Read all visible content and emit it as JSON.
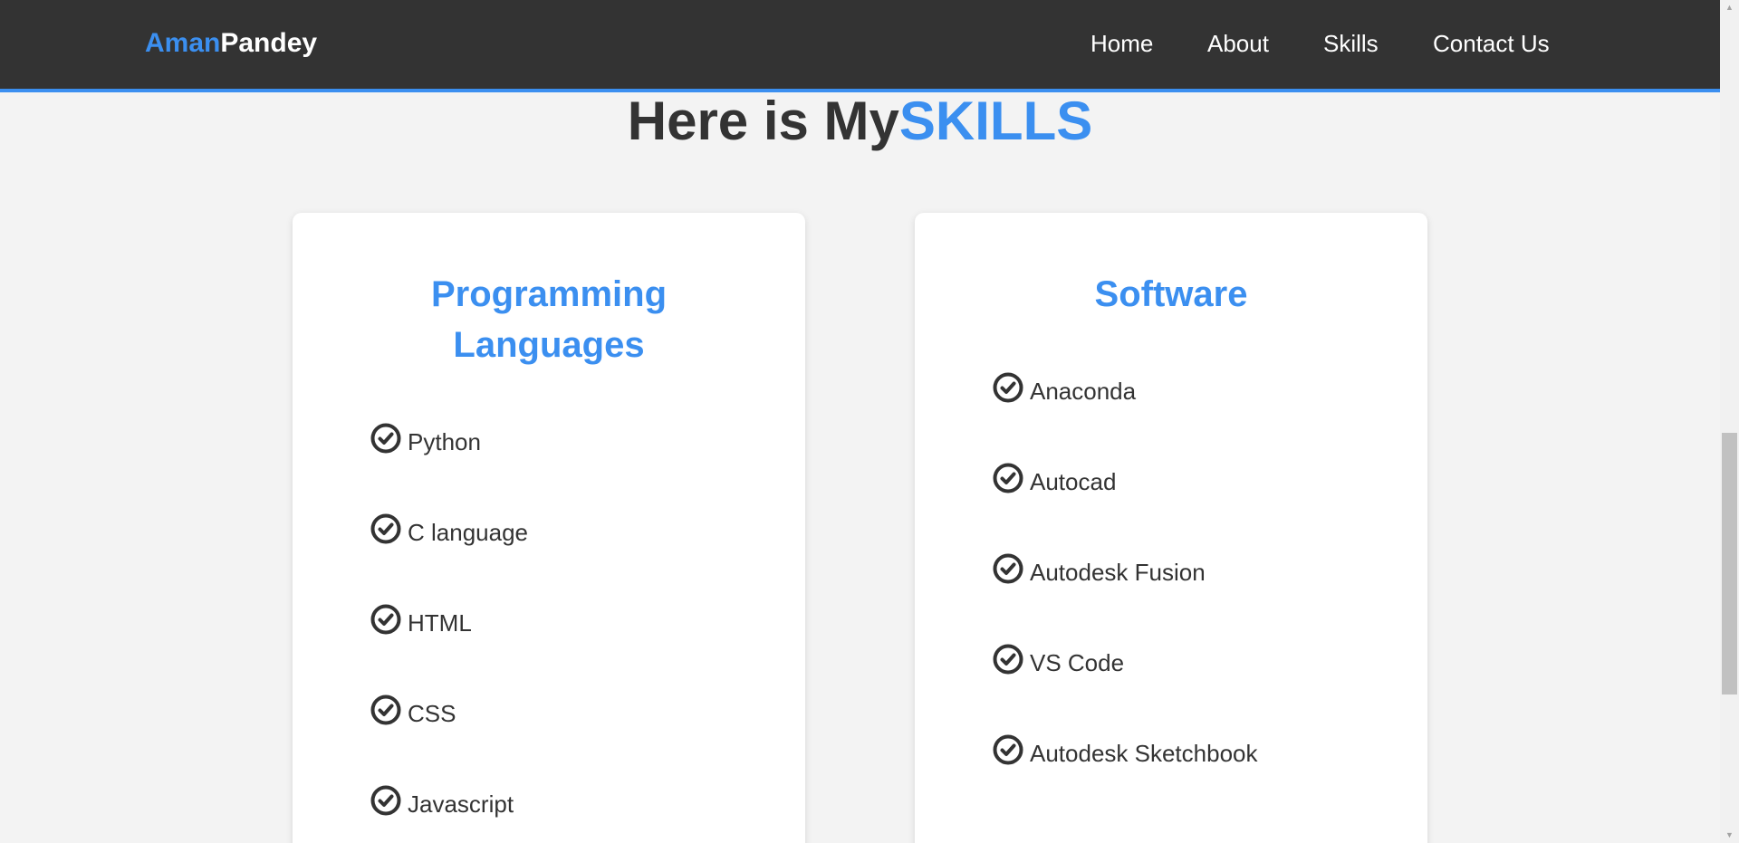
{
  "navbar": {
    "logo_first": "Aman",
    "logo_last": "Pandey",
    "links": [
      "Home",
      "About",
      "Skills",
      "Contact Us"
    ]
  },
  "heading": {
    "prefix": "Here is My",
    "accent": "SKILLS"
  },
  "cards": [
    {
      "title": "Programming Languages",
      "items": [
        "Python",
        "C language",
        "HTML",
        "CSS",
        "Javascript"
      ]
    },
    {
      "title": "Software",
      "items": [
        "Anaconda",
        "Autocad",
        "Autodesk Fusion",
        "VS Code",
        "Autodesk Sketchbook"
      ]
    }
  ],
  "icons": {
    "item": "check-circle-icon",
    "scroll_up": "arrow-up-icon",
    "scroll_down": "arrow-down-icon"
  },
  "colors": {
    "accent": "#3b8ff0",
    "navbar_bg": "#333333",
    "page_bg": "#f3f3f3",
    "text": "#333333"
  }
}
